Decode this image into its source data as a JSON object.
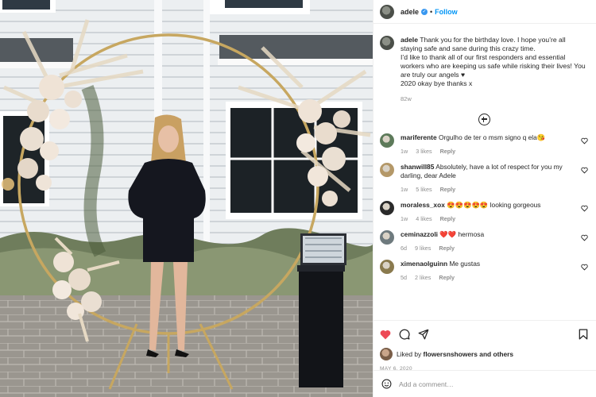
{
  "post": {
    "username": "adele",
    "follow_label": "Follow",
    "header_separator": "•",
    "caption": {
      "username": "adele",
      "text_line1": "Thank you for the birthday love. I hope you’re all staying safe and sane during this crazy time.",
      "text_line2": "I’d like to thank all of our first responders and essential workers who are keeping us safe while risking their lives! You are truly our angels ♥",
      "text_line3": "2020 okay bye thanks x",
      "age": "82w"
    },
    "comments": [
      {
        "username": "mariferente",
        "text": "Orgulho de ter o msm signo q ela😘",
        "age": "1w",
        "likes": "3 likes",
        "reply": "Reply",
        "avatar_color": "#5d7a5a"
      },
      {
        "username": "shanwill85",
        "text": "Absolutely, have a lot of respect for you my darling, dear Adele",
        "age": "1w",
        "likes": "5 likes",
        "reply": "Reply",
        "avatar_color": "#b49868"
      },
      {
        "username": "moraless_xox",
        "text": "😍😍😍😍😍 looking gorgeous",
        "age": "1w",
        "likes": "4 likes",
        "reply": "Reply",
        "avatar_color": "#2a2a2a"
      },
      {
        "username": "ceminazzoli",
        "text": "❤️❤️ hermosa",
        "age": "6d",
        "likes": "9 likes",
        "reply": "Reply",
        "avatar_color": "#6e7a7e"
      },
      {
        "username": "ximenaolguinn",
        "text": "Me gustas",
        "age": "5d",
        "likes": "2 likes",
        "reply": "Reply",
        "avatar_color": "#8a7a4e"
      }
    ],
    "liked_by_prefix": "Liked by",
    "liked_by_user": "flowersnshowers",
    "liked_by_suffix": "and others",
    "date": "MAY 6, 2020",
    "add_comment_placeholder": "Add a comment…"
  },
  "colors": {
    "like_red": "#ed4956",
    "link_blue": "#0095f6",
    "muted": "#8e8e8e"
  }
}
